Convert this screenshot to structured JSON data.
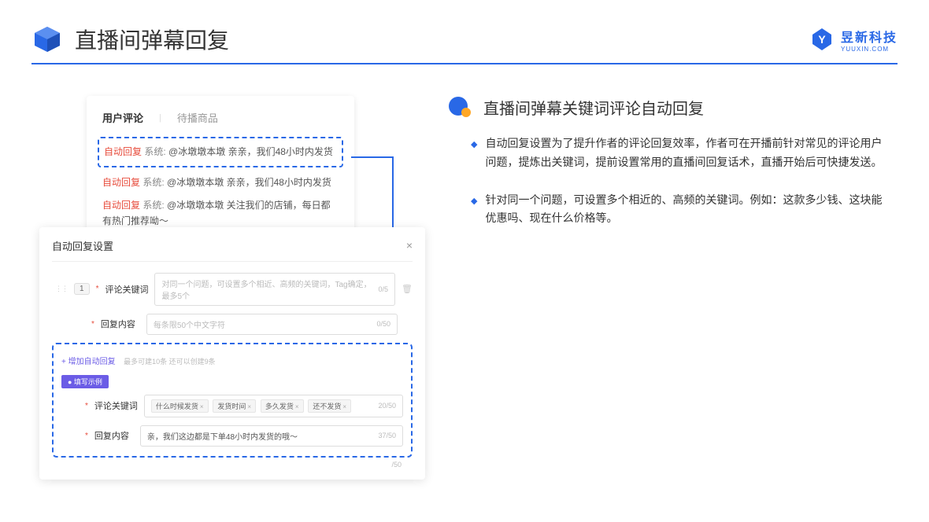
{
  "header": {
    "title": "直播间弹幕回复",
    "logo_main": "昱新科技",
    "logo_sub": "YUUXIN.COM"
  },
  "comments": {
    "tab1": "用户评论",
    "tab2": "待播商品",
    "tag_auto": "自动回复",
    "tag_sys": "系统:",
    "line1": "@冰墩墩本墩 亲亲，我们48小时内发货",
    "line2": "@冰墩墩本墩 亲亲，我们48小时内发货",
    "line3": "@冰墩墩本墩 关注我们的店铺，每日都有热门推荐呦～"
  },
  "settings": {
    "title": "自动回复设置",
    "close": "×",
    "idx": "1",
    "label_keyword": "评论关键词",
    "placeholder_keyword": "对同一个问题，可设置多个相近、高频的关键词，Tag确定，最多5个",
    "counter_keyword": "0/5",
    "label_reply": "回复内容",
    "placeholder_reply": "每条限50个中文字符",
    "counter_reply": "0/50",
    "add_text": "+ 增加自动回复",
    "add_hint": "最多可建10条 还可以创建9条",
    "example_badge": "● 填写示例",
    "example_kw_label": "评论关键词",
    "kw1": "什么时候发货",
    "kw2": "发货时间",
    "kw3": "多久发货",
    "kw4": "还不发货",
    "example_kw_counter": "20/50",
    "example_reply_label": "回复内容",
    "example_reply_val": "亲，我们这边都是下单48小时内发货的哦～",
    "example_reply_counter": "37/50",
    "extra_counter": "/50"
  },
  "right": {
    "section_title": "直播间弹幕关键词评论自动回复",
    "bullet1": "自动回复设置为了提升作者的评论回复效率，作者可在开播前针对常见的评论用户问题，提炼出关键词，提前设置常用的直播间回复话术，直播开始后可快捷发送。",
    "bullet2": "针对同一个问题，可设置多个相近的、高频的关键词。例如：这款多少钱、这块能优惠吗、现在什么价格等。"
  }
}
